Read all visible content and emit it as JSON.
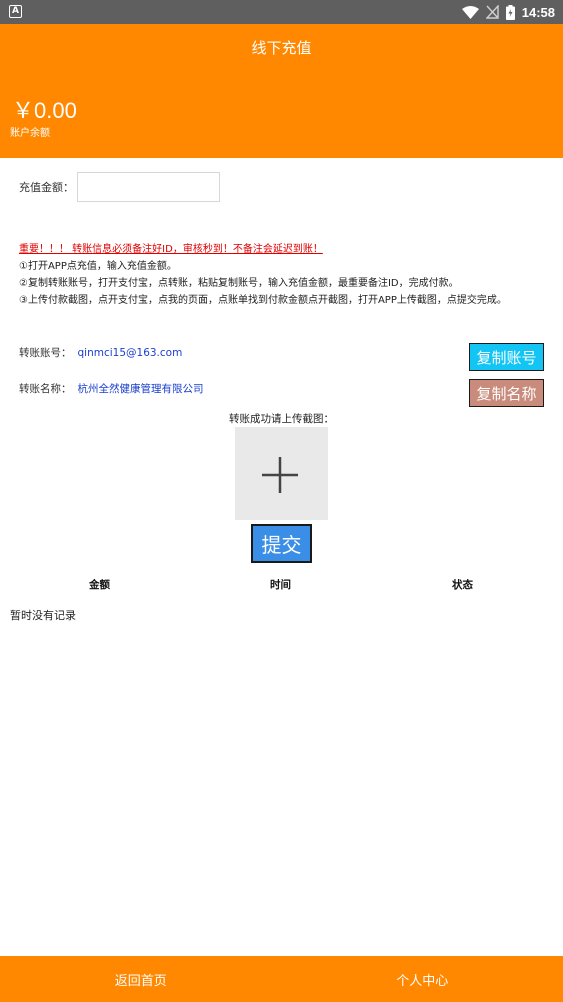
{
  "status_bar": {
    "time": "14:58",
    "app_badge": "A"
  },
  "header": {
    "title": "线下充值",
    "balance": "￥0.00",
    "balance_label": "账户余额"
  },
  "recharge": {
    "amount_label": "充值金额：",
    "amount_value": "",
    "amount_placeholder": ""
  },
  "notice": {
    "warning": "重要！！！ 转账信息必须备注好ID，审核秒到！不备注会延迟到账！",
    "steps": [
      "①打开APP点充值，输入充值金额。",
      "②复制转账账号，打开支付宝，点转账，粘贴复制账号，输入充值金额，最重要备注ID，完成付款。",
      "③上传付款截图，点开支付宝，点我的页面，点账单找到付款金额点开截图，打开APP上传截图，点提交完成。"
    ]
  },
  "transfer": {
    "account_label": "转账账号：",
    "account_value": "qinmci15@163.com",
    "copy_account_label": "复制账号",
    "name_label": "转账名称：",
    "name_value": "杭州全然健康管理有限公司",
    "copy_name_label": "复制名称"
  },
  "upload": {
    "label": "转账成功请上传截图："
  },
  "submit_label": "提交",
  "records": {
    "columns": [
      "金额",
      "时间",
      "状态"
    ],
    "empty_text": "暂时没有记录"
  },
  "bottom_nav": {
    "home": "返回首页",
    "profile": "个人中心"
  },
  "colors": {
    "primary": "#ff8800",
    "copy_account_btn": "#12c5f5",
    "copy_name_btn": "#c98b7b",
    "submit_btn": "#3a8ee6",
    "warning": "#e00000",
    "link_text": "#1a3fcf"
  }
}
